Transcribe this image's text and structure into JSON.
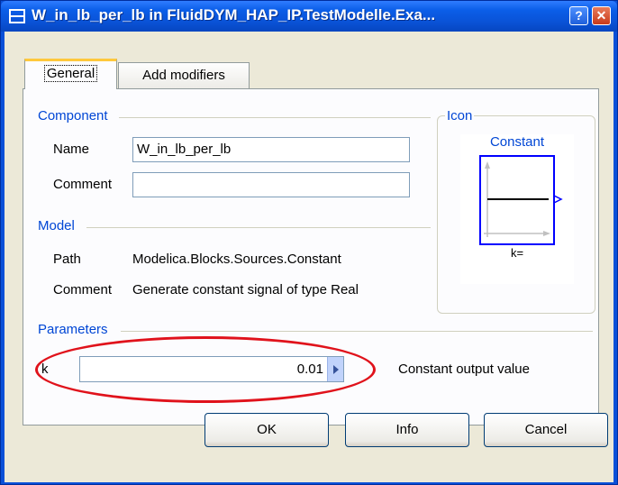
{
  "window": {
    "title": "W_in_lb_per_lb in FluidDYM_HAP_IP.TestModelle.Exa...",
    "help_symbol": "?",
    "close_symbol": "✕"
  },
  "tabs": [
    {
      "label": "General"
    },
    {
      "label": "Add modifiers"
    }
  ],
  "component": {
    "group_label": "Component",
    "name_label": "Name",
    "name_value": "W_in_lb_per_lb",
    "comment_label": "Comment",
    "comment_value": ""
  },
  "icon_group": {
    "label": "Icon",
    "block_title": "Constant",
    "block_caption": "k="
  },
  "model": {
    "group_label": "Model",
    "path_label": "Path",
    "path_value": "Modelica.Blocks.Sources.Constant",
    "comment_label": "Comment",
    "comment_value": "Generate constant signal of type Real"
  },
  "parameters": {
    "group_label": "Parameters",
    "k_label": "k",
    "k_value": "0.01",
    "k_description": "Constant output value"
  },
  "buttons": {
    "ok": "OK",
    "info": "Info",
    "cancel": "Cancel"
  },
  "colors": {
    "titlebar": "#0a52d6",
    "group_label": "#0046d5",
    "annotation_ellipse": "#e0121b"
  }
}
